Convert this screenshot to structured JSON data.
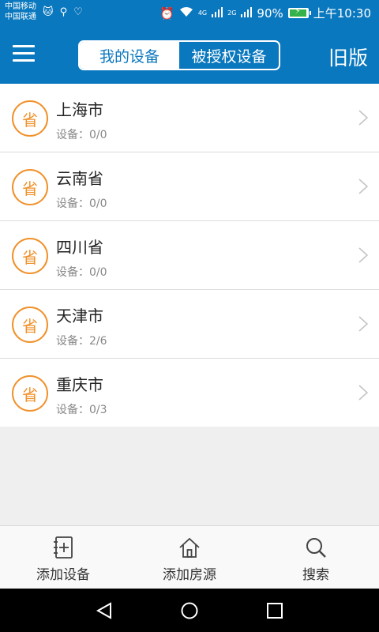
{
  "status_bar": {
    "carrier_1": "中国移动",
    "carrier_2": "中国联通",
    "network_4g": "4G",
    "network_2g": "2G",
    "battery": "90%",
    "time": "上午10:30"
  },
  "header": {
    "tabs": [
      {
        "label": "我的设备",
        "active": true
      },
      {
        "label": "被授权设备",
        "active": false
      }
    ],
    "old_version": "旧版"
  },
  "colors": {
    "accent": "#0a78be",
    "badge": "#f0912a"
  },
  "list": {
    "items": [
      {
        "badge": "省",
        "name": "上海市",
        "count": "设备：0/0"
      },
      {
        "badge": "省",
        "name": "云南省",
        "count": "设备：0/0"
      },
      {
        "badge": "省",
        "name": "四川省",
        "count": "设备：0/0"
      },
      {
        "badge": "省",
        "name": "天津市",
        "count": "设备：2/6"
      },
      {
        "badge": "省",
        "name": "重庆市",
        "count": "设备：0/3"
      }
    ]
  },
  "toolbar": {
    "add_device": "添加设备",
    "add_house": "添加房源",
    "search": "搜索"
  }
}
